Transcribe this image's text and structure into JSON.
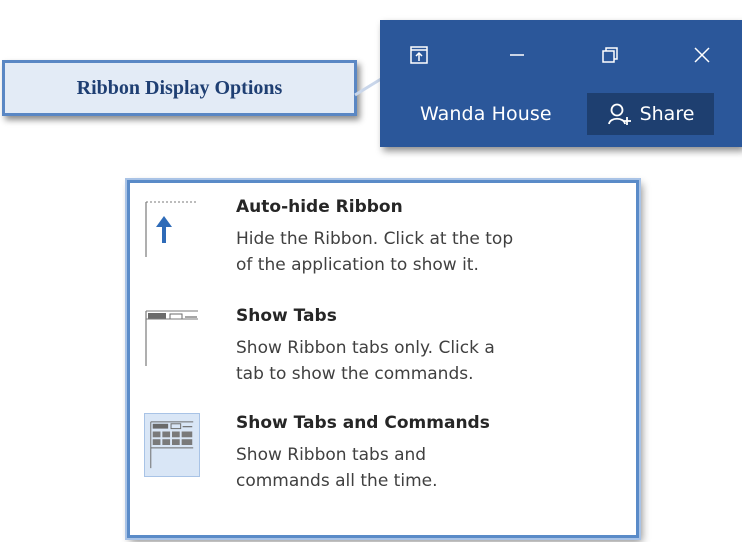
{
  "callout": {
    "label": "Ribbon Display Options"
  },
  "titlebar": {
    "background": "#2b579a",
    "buttons": [
      {
        "icon": "ribbon-display-options-icon"
      },
      {
        "icon": "minimize-icon"
      },
      {
        "icon": "restore-icon"
      },
      {
        "icon": "close-icon"
      }
    ],
    "user_name": "Wanda House",
    "share_label": "Share",
    "share_icon": "add-person-icon"
  },
  "menu": {
    "border_color": "#5a8bc8",
    "items": [
      {
        "icon": "auto-hide-ribbon-icon",
        "title": "Auto-hide Ribbon",
        "description": "Hide the Ribbon. Click at the top\nof the application to show it."
      },
      {
        "icon": "show-tabs-icon",
        "title": "Show Tabs",
        "description": "Show Ribbon tabs only. Click a\ntab to show the commands."
      },
      {
        "icon": "show-tabs-and-commands-icon",
        "title": "Show Tabs and Commands",
        "description": "Show Ribbon tabs and\ncommands all the time.",
        "selected": true
      }
    ]
  }
}
